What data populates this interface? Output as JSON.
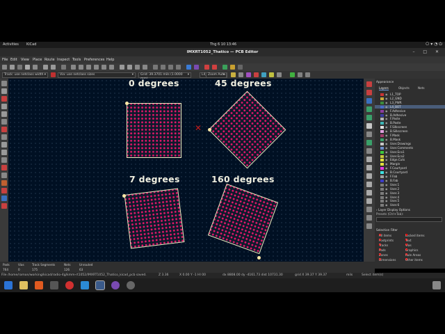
{
  "topbar": {
    "activities": "Activities",
    "app": "KiCad",
    "clock": "Thg 6 10  13:46",
    "tray": "⎔ ▾ ◔ ⏻"
  },
  "window": {
    "title": "IMXRT1052_Thatico — PCB Editor",
    "controls": "– □ ✕"
  },
  "menu": [
    "File",
    "Edit",
    "View",
    "Place",
    "Route",
    "Inspect",
    "Tools",
    "Preferences",
    "Help"
  ],
  "toolbar2": {
    "track_width": "Track: use netclass width",
    "via_size": "Via: use netclass sizes",
    "grid": "Grid: 39.3701 mils (1.0000 mm)",
    "layer": "L4_BOT (PgDn)",
    "zoom": "Zoom Auto"
  },
  "canvas": {
    "labels": [
      "0 degrees",
      "45 degrees",
      "7 degrees",
      "160 degrees"
    ],
    "cursor_mark": "✕"
  },
  "panel": {
    "header": "Appearance",
    "tabs": [
      "Layers",
      "Objects",
      "Nets"
    ],
    "layers": [
      {
        "name": "L1_TOP",
        "color": "#c83434"
      },
      {
        "name": "L2_GND",
        "color": "#c9a93c"
      },
      {
        "name": "L3_PWR",
        "color": "#3c8c3c"
      },
      {
        "name": "L4_BOT",
        "color": "#4a6cc8",
        "selected": true
      },
      {
        "name": "F.Adhesive",
        "color": "#8c3ca0"
      },
      {
        "name": "B.Adhesive",
        "color": "#3c3ca0"
      },
      {
        "name": "F.Paste",
        "color": "#b4b4b4"
      },
      {
        "name": "B.Paste",
        "color": "#3cb4b4"
      },
      {
        "name": "F.Silkscreen",
        "color": "#e0e0e0"
      },
      {
        "name": "B.Silkscreen",
        "color": "#e0a0e0"
      },
      {
        "name": "F.Mask",
        "color": "#a03c6c"
      },
      {
        "name": "B.Mask",
        "color": "#3ca06c"
      },
      {
        "name": "User.Drawings",
        "color": "#c8c8c8"
      },
      {
        "name": "User.Comments",
        "color": "#6c8cc8"
      },
      {
        "name": "User.Eco1",
        "color": "#3cc83c"
      },
      {
        "name": "User.Eco2",
        "color": "#c8c83c"
      },
      {
        "name": "Edge.Cuts",
        "color": "#e0e03c"
      },
      {
        "name": "Margin",
        "color": "#e0e03c"
      },
      {
        "name": "F.Courtyard",
        "color": "#e03ce0"
      },
      {
        "name": "B.Courtyard",
        "color": "#3ce0e0"
      },
      {
        "name": "F.Fab",
        "color": "#a0a0a0"
      },
      {
        "name": "B.Fab",
        "color": "#3c3cc8"
      },
      {
        "name": "User.1",
        "color": "#7c7c7c"
      },
      {
        "name": "User.2",
        "color": "#7c7c7c"
      },
      {
        "name": "User.3",
        "color": "#7c7c7c"
      },
      {
        "name": "User.4",
        "color": "#7c7c7c"
      },
      {
        "name": "User.5",
        "color": "#7c7c7c"
      },
      {
        "name": "User.6",
        "color": "#7c7c7c"
      }
    ],
    "layer_display": "› Layer Display Options",
    "presets_label": "Presets (Ctrl+Tab):",
    "selection_filter": "Selection Filter",
    "filters": [
      "All items",
      "Locked items",
      "Footprints",
      "Text",
      "Tracks",
      "Vias",
      "Pads",
      "Graphics",
      "Zones",
      "Rule Areas",
      "Dimensions",
      "Other items"
    ]
  },
  "status": {
    "pads_label": "Pads",
    "pads": "764",
    "vias_label": "Vias",
    "vias": "0",
    "tracks_label": "Track Segments",
    "tracks": "175",
    "nets_label": "Nets",
    "nets": "126",
    "unrouted_label": "Unrouted",
    "unrouted": "63"
  },
  "message": {
    "file": "File /home/ramon/working/kicad/radio-4g/kmm-rt1052/IMXRT1052_Thatico_kicad_pcb saved.",
    "zoom": "Z 3.36",
    "xy": "X 0.00 Y -1 HI 00",
    "dist": "dx 8808.00  dy -4161.73  dist 10731.30",
    "grid": "grid X 39.37  Y 39.37",
    "units": "mils",
    "hint": "Select item(s)"
  }
}
